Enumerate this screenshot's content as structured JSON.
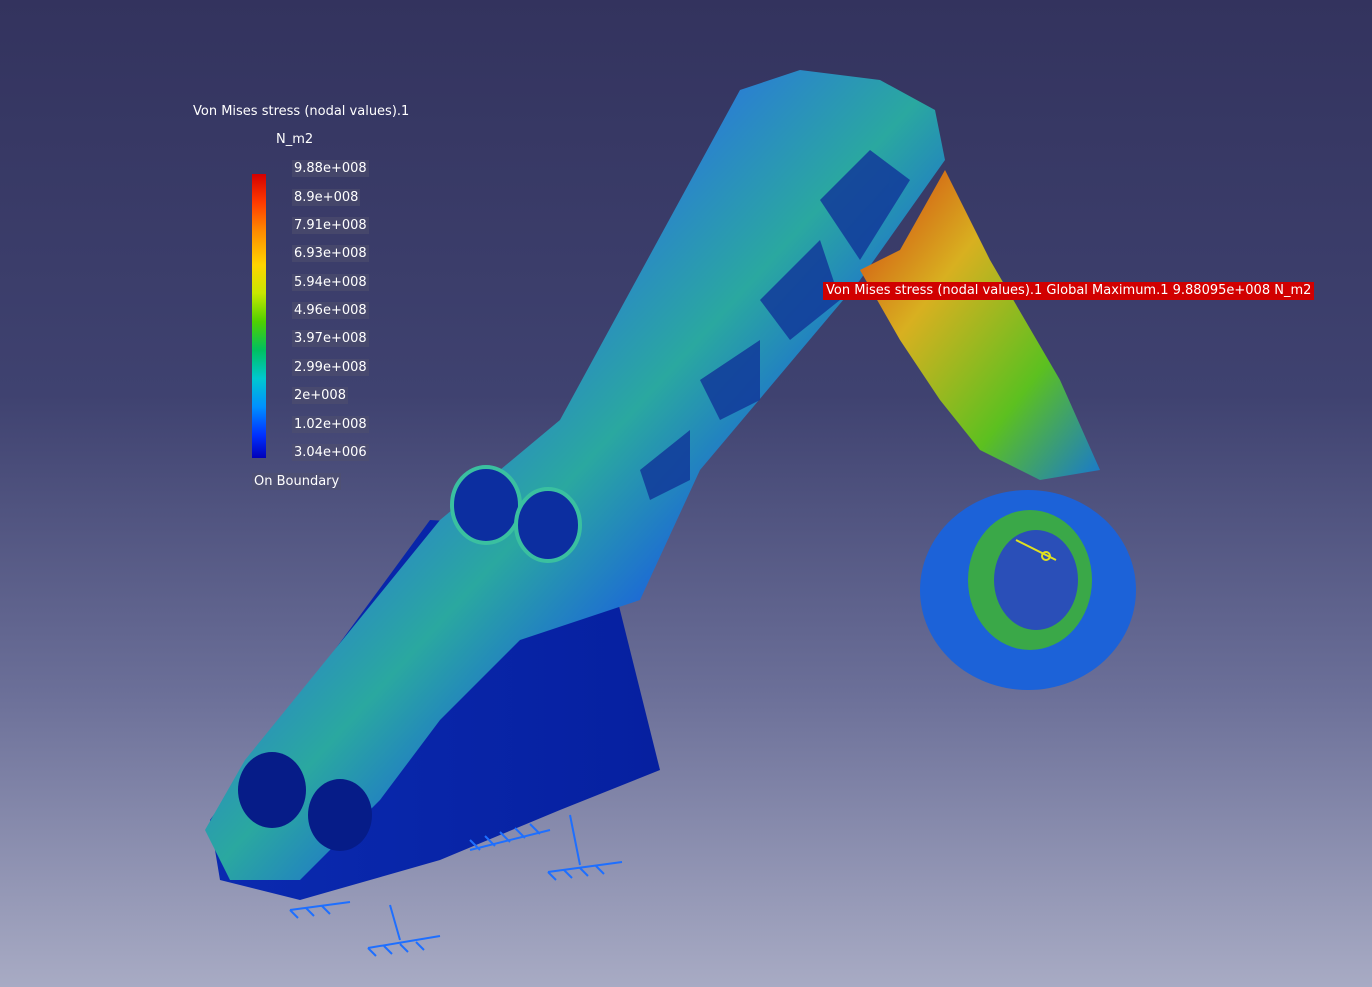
{
  "legend": {
    "title": "Von Mises stress (nodal values).1",
    "unit": "N_m2",
    "ticks": [
      "9.88e+008",
      "8.9e+008",
      "7.91e+008",
      "6.93e+008",
      "5.94e+008",
      "4.96e+008",
      "3.97e+008",
      "2.99e+008",
      "2e+008",
      "1.02e+008",
      "3.04e+006"
    ],
    "boundary_label": "On Boundary",
    "colors": [
      "#d40000",
      "#ff8a00",
      "#ffd400",
      "#4fd000",
      "#00c8d0",
      "#0030ff",
      "#0000b8"
    ]
  },
  "annotation": {
    "max_label": "Von Mises stress (nodal values).1  Global Maximum.1  9.88095e+008 N_m2",
    "color": "#d10000"
  },
  "background": {
    "top": "#33335e",
    "bottom": "#a8abc4"
  }
}
